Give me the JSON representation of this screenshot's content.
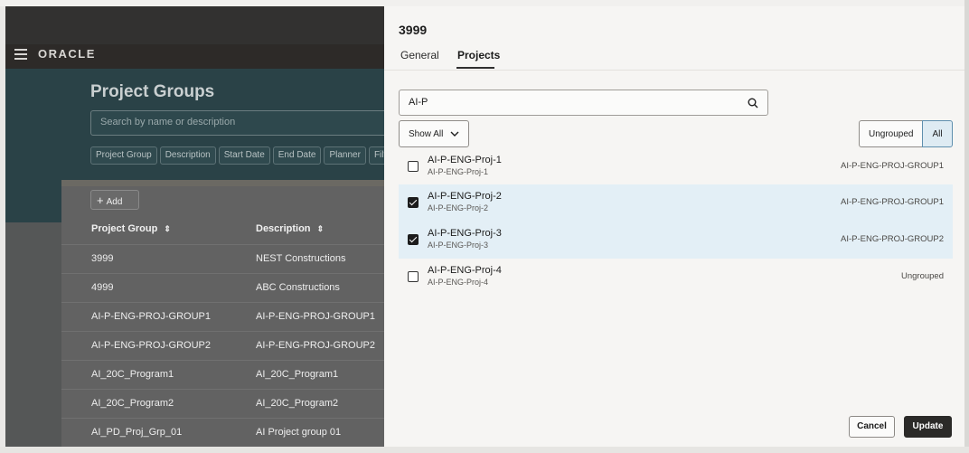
{
  "background_app": {
    "logo": "ORACLE",
    "page_title": "Project Groups",
    "search_placeholder": "Search by name or description",
    "filter_chips": [
      "Project Group",
      "Description",
      "Start Date",
      "End Date",
      "Planner",
      "Filt"
    ],
    "add_label": "Add",
    "columns": [
      "Project Group",
      "Description"
    ],
    "rows": [
      [
        "3999",
        "NEST Constructions"
      ],
      [
        "4999",
        "ABC Constructions"
      ],
      [
        "AI-P-ENG-PROJ-GROUP1",
        "AI-P-ENG-PROJ-GROUP1"
      ],
      [
        "AI-P-ENG-PROJ-GROUP2",
        "AI-P-ENG-PROJ-GROUP2"
      ],
      [
        "AI_20C_Program1",
        "AI_20C_Program1"
      ],
      [
        "AI_20C_Program2",
        "AI_20C_Program2"
      ],
      [
        "AI_PD_Proj_Grp_01",
        "AI Project group 01"
      ]
    ]
  },
  "drawer": {
    "title": "3999",
    "tabs": [
      {
        "label": "General",
        "active": false
      },
      {
        "label": "Projects",
        "active": true
      }
    ],
    "search": {
      "value": "AI-P",
      "placeholder": ""
    },
    "show_all_label": "Show All",
    "segments": [
      {
        "label": "Ungrouped",
        "selected": false
      },
      {
        "label": "All",
        "selected": true
      }
    ],
    "items": [
      {
        "name": "AI-P-ENG-Proj-1",
        "sub": "AI-P-ENG-Proj-1",
        "group": "AI-P-ENG-PROJ-GROUP1",
        "checked": false
      },
      {
        "name": "AI-P-ENG-Proj-2",
        "sub": "AI-P-ENG-Proj-2",
        "group": "AI-P-ENG-PROJ-GROUP1",
        "checked": true
      },
      {
        "name": "AI-P-ENG-Proj-3",
        "sub": "AI-P-ENG-Proj-3",
        "group": "AI-P-ENG-PROJ-GROUP2",
        "checked": true
      },
      {
        "name": "AI-P-ENG-Proj-4",
        "sub": "AI-P-ENG-Proj-4",
        "group": "Ungrouped",
        "checked": false
      }
    ],
    "cancel_label": "Cancel",
    "update_label": "Update"
  },
  "colors": {
    "hero": "#2a4247",
    "selected_row": "#e3eff6",
    "primary_button": "#2b2a28"
  }
}
